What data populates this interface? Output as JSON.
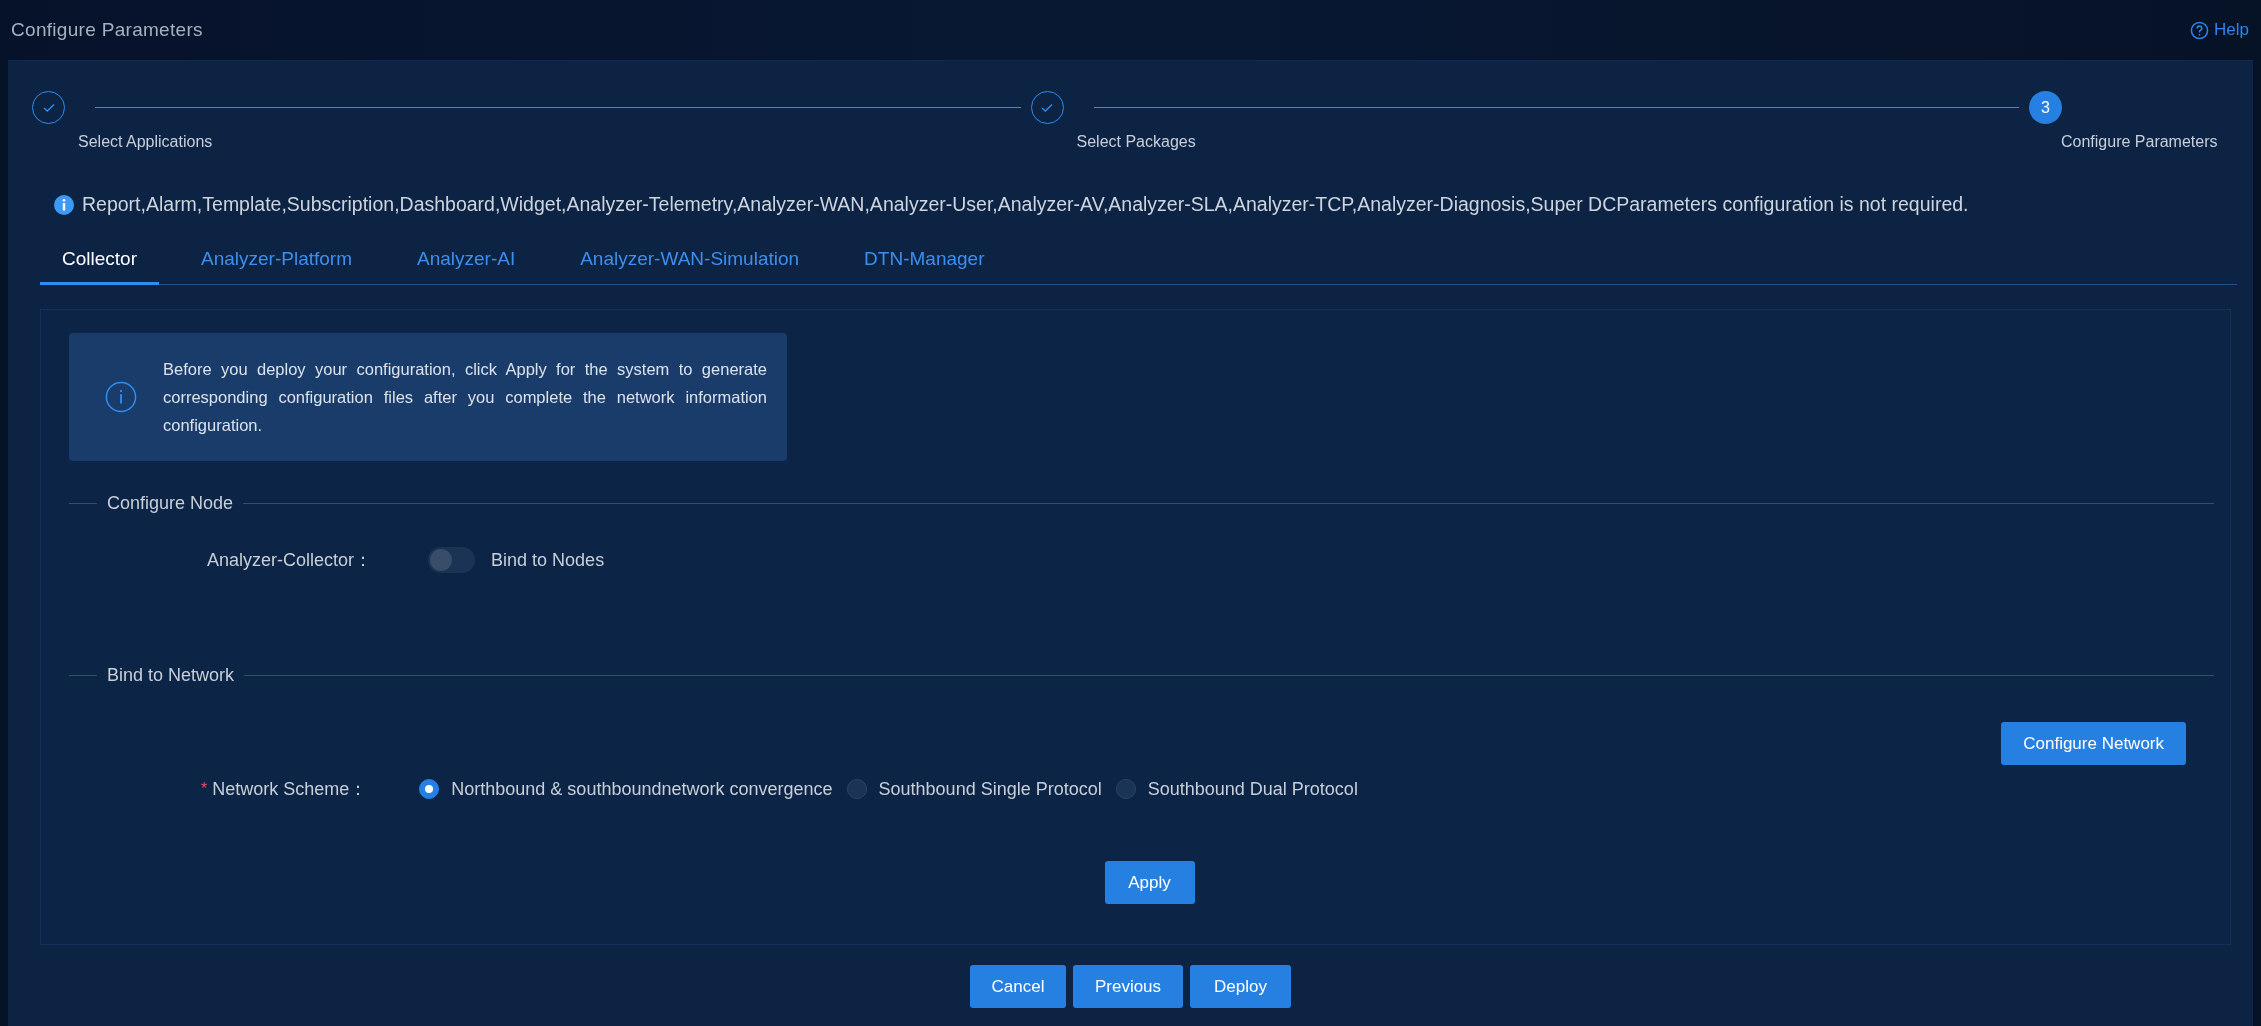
{
  "window": {
    "title": "Configure Parameters",
    "help": "Help"
  },
  "steps": [
    {
      "label": "Select Applications",
      "completed": true,
      "active": false
    },
    {
      "label": "Select Packages",
      "completed": true,
      "active": false
    },
    {
      "label": "Configure Parameters",
      "completed": false,
      "active": true,
      "number": "3"
    }
  ],
  "notice": "Report,Alarm,Template,Subscription,Dashboard,Widget,Analyzer-Telemetry,Analyzer-WAN,Analyzer-User,Analyzer-AV,Analyzer-SLA,Analyzer-TCP,Analyzer-Diagnosis,Super DCParameters configuration is not required.",
  "tabs": [
    {
      "label": "Collector",
      "selected": true
    },
    {
      "label": "Analyzer-Platform",
      "selected": false
    },
    {
      "label": "Analyzer-AI",
      "selected": false
    },
    {
      "label": "Analyzer-WAN-Simulation",
      "selected": false
    },
    {
      "label": "DTN-Manager",
      "selected": false
    }
  ],
  "info_box": "Before you deploy your configuration, click Apply for the system to generate corresponding configuration files after you complete the network information configuration.",
  "configure_node": {
    "legend": "Configure Node",
    "label": "Analyzer-Collector：",
    "toggle": {
      "on": false,
      "label": "Bind to Nodes"
    }
  },
  "bind_network": {
    "legend": "Bind to Network",
    "button": "Configure Network",
    "required_mark": "*",
    "label": "Network Scheme：",
    "options": [
      {
        "label": "Northbound & southboundnetwork convergence",
        "selected": true
      },
      {
        "label": "Southbound Single Protocol",
        "selected": false
      },
      {
        "label": "Southbound Dual Protocol",
        "selected": false
      }
    ]
  },
  "apply_button": "Apply",
  "footer_buttons": [
    "Cancel",
    "Previous",
    "Deploy"
  ]
}
